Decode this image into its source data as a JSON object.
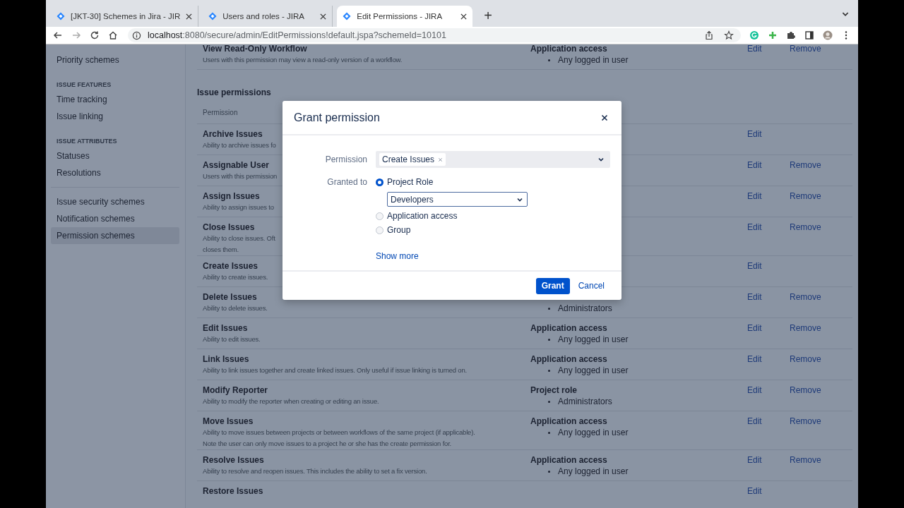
{
  "browser": {
    "tabs": [
      {
        "title": "[JKT-30] Schemes in Jira - JIR",
        "selected": false
      },
      {
        "title": "Users and roles - JIRA",
        "selected": false
      },
      {
        "title": "Edit Permissions - JIRA",
        "selected": true
      }
    ],
    "new_tab": "+",
    "url_host": "localhost",
    "url_path": ":8080/secure/admin/EditPermissions!default.jspa?schemeId=10101"
  },
  "sidebar": {
    "items": [
      {
        "kind": "link",
        "label": "Priority schemes",
        "selected": false
      },
      {
        "kind": "heading",
        "label": "ISSUE FEATURES"
      },
      {
        "kind": "link",
        "label": "Time tracking",
        "selected": false
      },
      {
        "kind": "link",
        "label": "Issue linking",
        "selected": false
      },
      {
        "kind": "heading",
        "label": "ISSUE ATTRIBUTES"
      },
      {
        "kind": "link",
        "label": "Statuses",
        "selected": false
      },
      {
        "kind": "link",
        "label": "Resolutions",
        "selected": false
      },
      {
        "kind": "divider"
      },
      {
        "kind": "link",
        "label": "Issue security schemes",
        "selected": false
      },
      {
        "kind": "link",
        "label": "Notification schemes",
        "selected": false
      },
      {
        "kind": "link",
        "label": "Permission schemes",
        "selected": true
      }
    ]
  },
  "top_rows": [
    {
      "name": "View Read-Only Workflow",
      "description": [
        "Users with this permission may view a read-only version of a workflow."
      ],
      "grants": [
        {
          "type": "Application access",
          "members": [
            "Any logged in user"
          ]
        }
      ],
      "actions": [
        "Edit",
        "Remove"
      ]
    }
  ],
  "issue_permissions": {
    "title": "Issue permissions",
    "column": "Permission",
    "rows": [
      {
        "name": "Archive Issues",
        "description": [
          "Ability to archive issues fo"
        ],
        "grants": [],
        "actions": [
          "Edit"
        ]
      },
      {
        "name": "Assignable User",
        "description": [
          "Users with this permission"
        ],
        "grants": [],
        "actions": [
          "Edit",
          "Remove"
        ]
      },
      {
        "name": "Assign Issues",
        "description": [
          "Ability to assign issues to"
        ],
        "grants": [],
        "actions": [
          "Edit",
          "Remove"
        ]
      },
      {
        "name": "Close Issues",
        "description": [
          "Ability to close issues. Oft",
          "closes them."
        ],
        "grants": [],
        "actions": [
          "Edit",
          "Remove"
        ]
      },
      {
        "name": "Create Issues",
        "description": [
          "Ability to create issues."
        ],
        "grants": [],
        "actions": [
          "Edit"
        ]
      },
      {
        "name": "Delete Issues",
        "description": [
          "Ability to delete issues."
        ],
        "grants": [
          {
            "members": [
              "Administrators"
            ]
          }
        ],
        "actions": [
          "Edit",
          "Remove"
        ]
      },
      {
        "name": "Edit Issues",
        "description": [
          "Ability to edit issues."
        ],
        "grants": [
          {
            "type": "Application access",
            "members": [
              "Any logged in user"
            ]
          }
        ],
        "actions": [
          "Edit",
          "Remove"
        ]
      },
      {
        "name": "Link Issues",
        "description": [
          "Ability to link issues together and create linked issues. Only useful if issue linking is turned on."
        ],
        "grants": [
          {
            "type": "Application access",
            "members": [
              "Any logged in user"
            ]
          }
        ],
        "actions": [
          "Edit",
          "Remove"
        ]
      },
      {
        "name": "Modify Reporter",
        "description": [
          "Ability to modify the reporter when creating or editing an issue."
        ],
        "grants": [
          {
            "type": "Project role",
            "members": [
              "Administrators"
            ]
          }
        ],
        "actions": [
          "Edit",
          "Remove"
        ]
      },
      {
        "name": "Move Issues",
        "description": [
          "Ability to move issues between projects or between workflows of the same project (if applicable).",
          "Note the user can only move issues to a project he or she has the create permission for."
        ],
        "grants": [
          {
            "type": "Application access",
            "members": [
              "Any logged in user"
            ]
          }
        ],
        "actions": [
          "Edit",
          "Remove"
        ]
      },
      {
        "name": "Resolve Issues",
        "description": [
          "Ability to resolve and reopen issues. This includes the ability to set a fix version."
        ],
        "grants": [
          {
            "type": "Application access",
            "members": [
              "Any logged in user"
            ]
          }
        ],
        "actions": [
          "Edit",
          "Remove"
        ]
      },
      {
        "name": "Restore Issues",
        "description": [],
        "grants": [],
        "actions": [
          "Edit"
        ]
      }
    ]
  },
  "dialog": {
    "title": "Grant permission",
    "permission_label": "Permission",
    "permission_value": "Create Issues",
    "granted_label": "Granted to",
    "options": [
      {
        "label": "Project Role",
        "selected": true,
        "select": "Developers"
      },
      {
        "label": "Application access",
        "selected": false
      },
      {
        "label": "Group",
        "selected": false
      }
    ],
    "show_more": "Show more",
    "buttons": [
      {
        "label": "Grant",
        "kind": "primary"
      },
      {
        "label": "Cancel",
        "kind": "link"
      }
    ]
  }
}
